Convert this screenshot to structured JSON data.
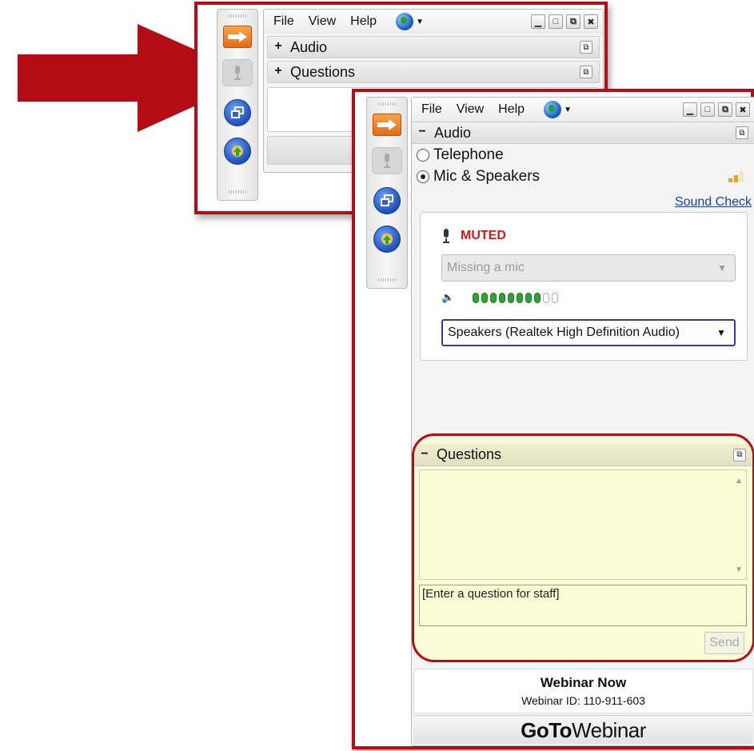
{
  "menu": {
    "file": "File",
    "view": "View",
    "help": "Help"
  },
  "window_buttons": {
    "minimize": "▁",
    "maximize": "□",
    "restore": "⧉",
    "close": "✖"
  },
  "collapsed_view": {
    "sections": [
      {
        "toggle": "+",
        "title": "Audio"
      },
      {
        "toggle": "+",
        "title": "Questions"
      }
    ]
  },
  "audio": {
    "toggle": "−",
    "title": "Audio",
    "options": [
      {
        "label": "Telephone",
        "selected": false
      },
      {
        "label": "Mic & Speakers",
        "selected": true
      }
    ],
    "sound_check": "Sound Check",
    "mic_status": "MUTED",
    "mic_device": "Missing a mic",
    "speaker_device": "Speakers (Realtek High Definition Audio)",
    "speaker_level_fraction": 0.8
  },
  "questions": {
    "toggle": "−",
    "title": "Questions",
    "input_placeholder": "[Enter a question for staff]",
    "send_label": "Send"
  },
  "webinar": {
    "name": "Webinar Now",
    "id_text": "Webinar ID: 110-911-603"
  },
  "brand": {
    "part1": "GoTo",
    "part2": "Webinar"
  },
  "colors": {
    "highlight": "#b50d16",
    "muted": "#d11a1a",
    "link": "#1a3fb5",
    "questions_bg": "#fdfcd9"
  }
}
